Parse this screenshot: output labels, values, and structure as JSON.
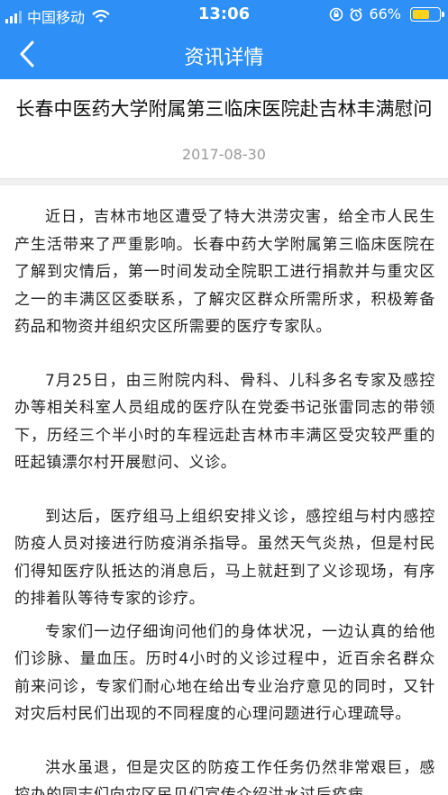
{
  "status_bar": {
    "carrier": "中国移动",
    "time": "13:06",
    "battery": "66%",
    "battery_level": 0.66,
    "battery_color": "#ffd21f"
  },
  "nav": {
    "title": "资讯详情",
    "background": "#2e90f6"
  },
  "article": {
    "title": "长春中医药大学附属第三临床医院赴吉林丰满慰问",
    "date": "2017-08-30",
    "paragraphs": [
      "近日，吉林市地区遭受了特大洪涝灾害，给全市人民生产生活带来了严重影响。长春中药大学附属第三临床医院在了解到灾情后，第一时间发动全院职工进行捐款并与重灾区之一的丰满区区委联系，了解灾区群众所需所求，积极筹备药品和物资并组织灾区所需要的医疗专家队。",
      "7月25日，由三附院内科、骨科、儿科多名专家及感控办等相关科室人员组成的医疗队在党委书记张雷同志的带领下，历经三个半小时的车程远赴吉林市丰满区受灾较严重的旺起镇漂尔村开展慰问、义诊。",
      "到达后，医疗组马上组织安排义诊，感控组与村内感控防疫人员对接进行防疫消杀指导。虽然天气炎热，但是村民们得知医疗队抵达的消息后，马上就赶到了义诊现场，有序的排着队等待专家的诊疗。",
      "专家们一边仔细询问他们的身体状况，一边认真的给他们诊脉、量血压。历时4小时的义诊过程中，近百余名群众前来问诊，专家们耐心地在给出专业治疗意见的同时，又针对灾后村民们出现的不同程度的心理问题进行心理疏导。",
      "洪水虽退，但是灾区的防疫工作任务仍然非常艰巨，感控办的同志们向灾区民见们宣传介绍洪水过后疫病"
    ]
  }
}
